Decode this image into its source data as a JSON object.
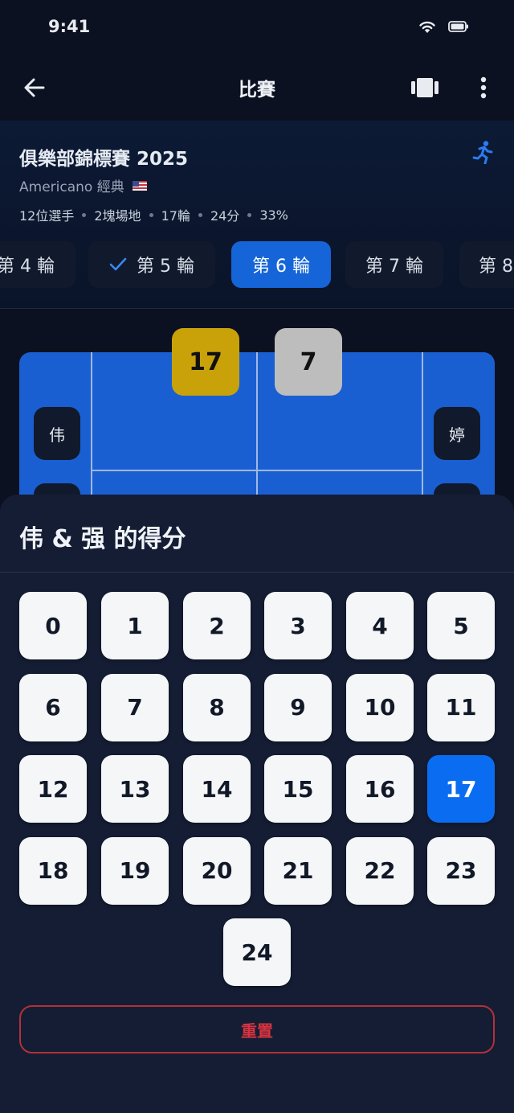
{
  "status_bar": {
    "time": "9:41"
  },
  "app_bar": {
    "title": "比賽",
    "back_icon": "arrow-left-icon",
    "mode_icon": "court-icon",
    "more_icon": "more-vertical-icon"
  },
  "tournament": {
    "name": "俱樂部錦標賽 2025",
    "format": "Americano 經典",
    "flag": "us-flag",
    "meta": [
      "12位選手",
      "2塊場地",
      "17輪",
      "24分",
      "33%"
    ]
  },
  "rounds": [
    {
      "label": "第 4 輪",
      "done": false,
      "active": false
    },
    {
      "label": "第 5 輪",
      "done": true,
      "active": false
    },
    {
      "label": "第 6 輪",
      "done": false,
      "active": true
    },
    {
      "label": "第 7 輪",
      "done": false,
      "active": false
    },
    {
      "label": "第 8",
      "done": false,
      "active": false
    }
  ],
  "court": {
    "score_left": "17",
    "score_right": "7",
    "score_left_color": "#c9a20a",
    "score_right_color": "#bdbdbd",
    "player_left": "伟",
    "player_right": "婷"
  },
  "sheet": {
    "title": "伟 & 强 的得分",
    "keys": [
      "0",
      "1",
      "2",
      "3",
      "4",
      "5",
      "6",
      "7",
      "8",
      "9",
      "10",
      "11",
      "12",
      "13",
      "14",
      "15",
      "16",
      "17",
      "18",
      "19",
      "20",
      "21",
      "22",
      "23",
      "24"
    ],
    "selected": "17",
    "reset_label": "重置"
  },
  "colors": {
    "accent": "#1565d8",
    "danger": "#d7333f",
    "court": "#1a5fd2"
  }
}
